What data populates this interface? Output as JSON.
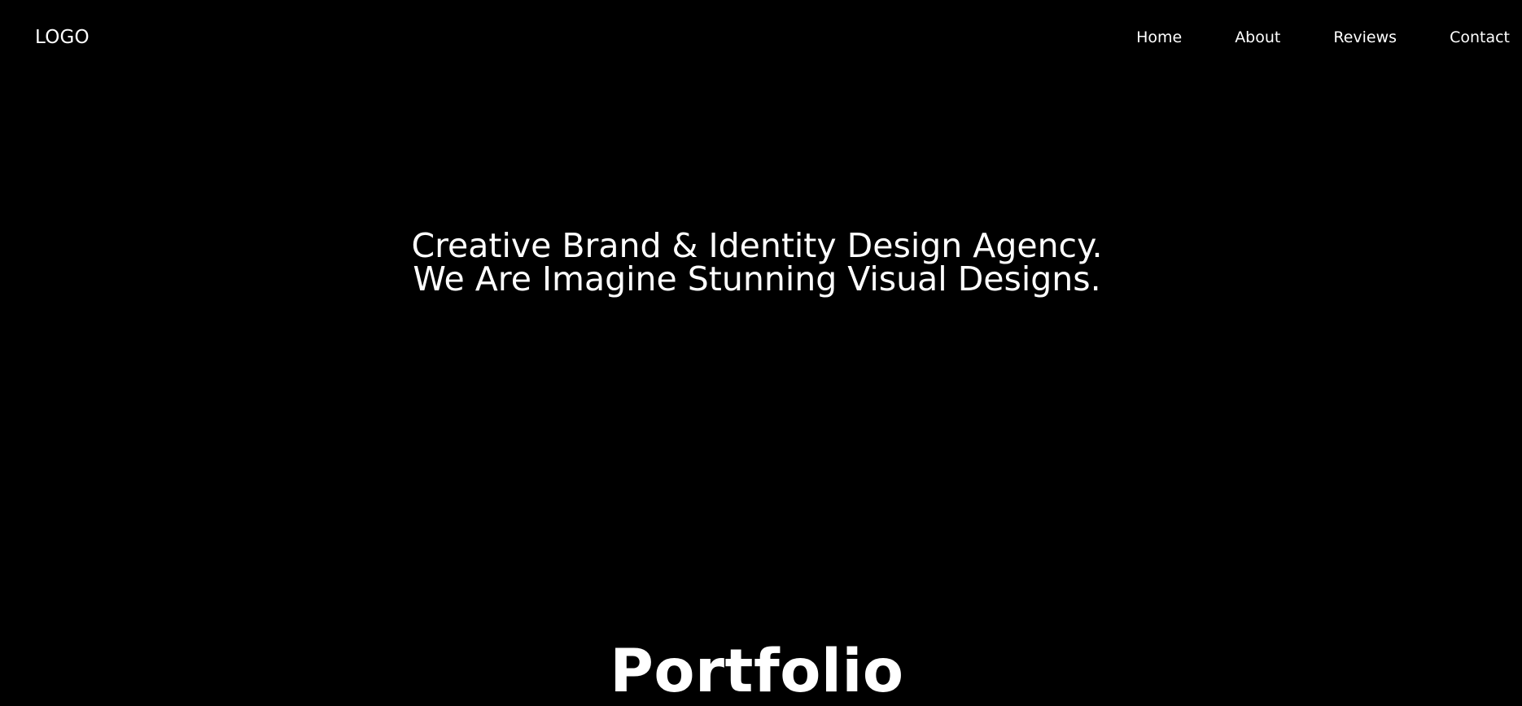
{
  "header": {
    "logo": "LOGO",
    "nav": {
      "home": "Home",
      "about": "About",
      "reviews": "Reviews",
      "contact": "Contact"
    }
  },
  "hero": {
    "headline": "Creative Brand & Identity Design Agency. We Are Imagine Stunning Visual Designs."
  },
  "sections": {
    "portfolio_title": "Portfolio"
  },
  "colors": {
    "background": "#000000",
    "text": "#ffffff"
  }
}
